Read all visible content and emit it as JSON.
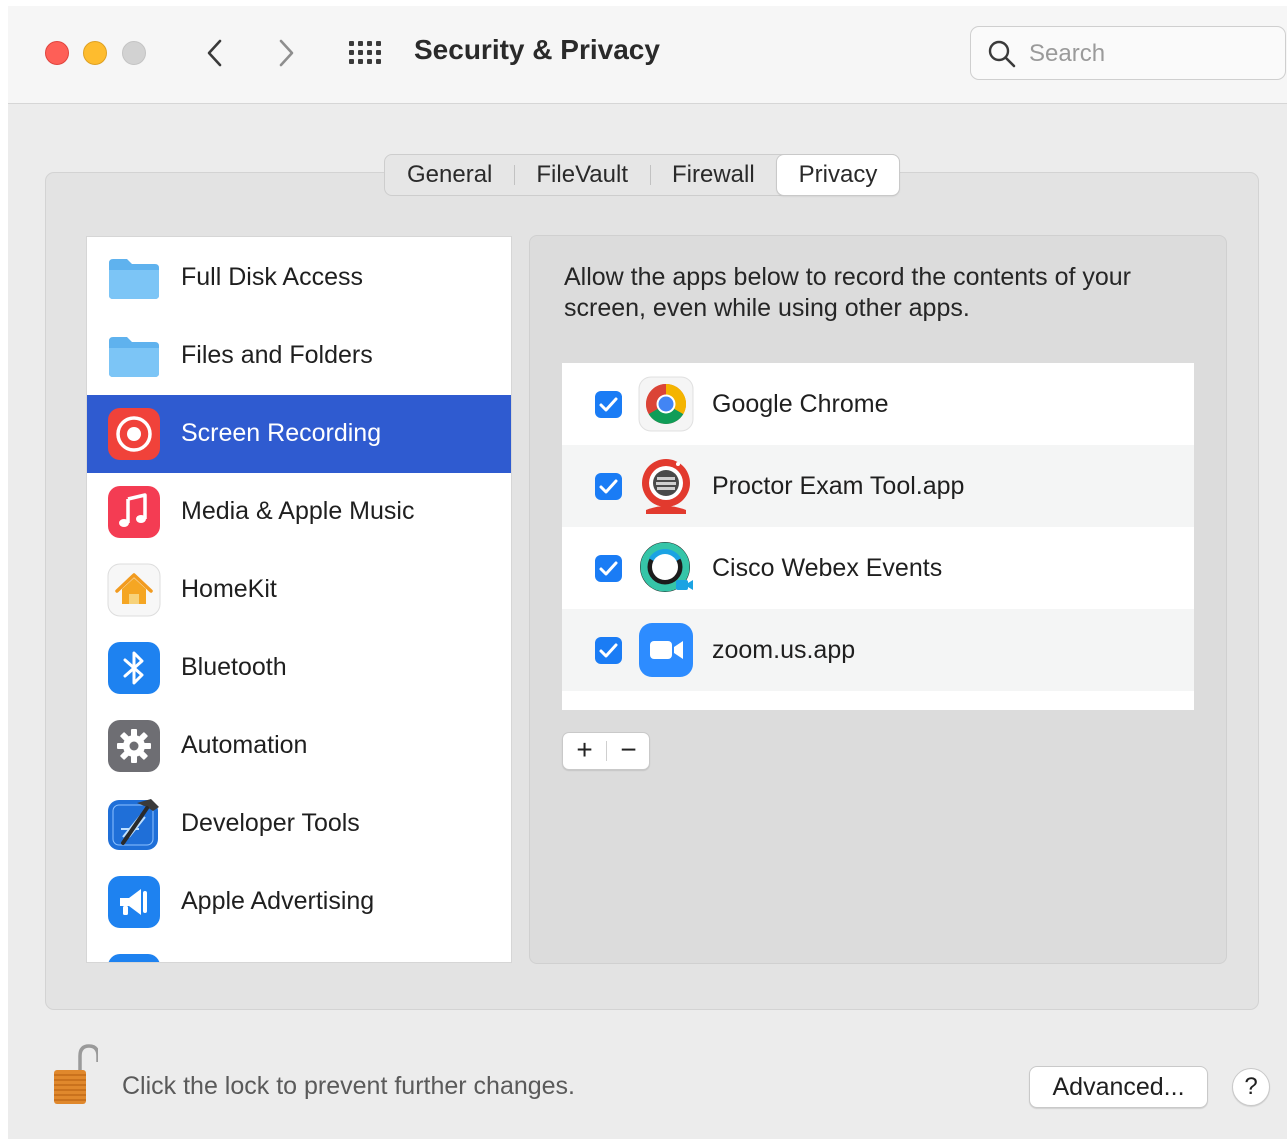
{
  "window": {
    "title": "Security & Privacy",
    "search": {
      "placeholder": "Search",
      "value": ""
    }
  },
  "tabs": [
    {
      "label": "General",
      "active": false
    },
    {
      "label": "FileVault",
      "active": false
    },
    {
      "label": "Firewall",
      "active": false
    },
    {
      "label": "Privacy",
      "active": true
    }
  ],
  "sidebar": {
    "items": [
      {
        "label": "Full Disk Access",
        "icon": "folder-icon"
      },
      {
        "label": "Files and Folders",
        "icon": "folder-icon"
      },
      {
        "label": "Screen Recording",
        "icon": "screen-recording-icon",
        "selected": true
      },
      {
        "label": "Media & Apple Music",
        "icon": "music-note-icon"
      },
      {
        "label": "HomeKit",
        "icon": "home-icon"
      },
      {
        "label": "Bluetooth",
        "icon": "bluetooth-icon"
      },
      {
        "label": "Automation",
        "icon": "gear-icon"
      },
      {
        "label": "Developer Tools",
        "icon": "hammer-icon"
      },
      {
        "label": "Apple Advertising",
        "icon": "megaphone-icon"
      }
    ]
  },
  "privacy": {
    "description": "Allow the apps below to record the contents of your screen, even while using other apps.",
    "apps": [
      {
        "name": "Google Chrome",
        "checked": true,
        "icon": "chrome-icon"
      },
      {
        "name": "Proctor Exam Tool.app",
        "checked": true,
        "icon": "proctor-icon"
      },
      {
        "name": "Cisco Webex Events",
        "checked": true,
        "icon": "webex-icon"
      },
      {
        "name": "zoom.us.app",
        "checked": true,
        "icon": "zoom-icon"
      }
    ],
    "add_label": "+",
    "remove_label": "−"
  },
  "footer": {
    "lock_text": "Click the lock to prevent further changes.",
    "advanced_label": "Advanced...",
    "help_label": "?"
  },
  "colors": {
    "selection": "#2f5bd0",
    "checkbox": "#1a7cf5",
    "close": "#fe5f57",
    "minimize": "#febc2e"
  }
}
